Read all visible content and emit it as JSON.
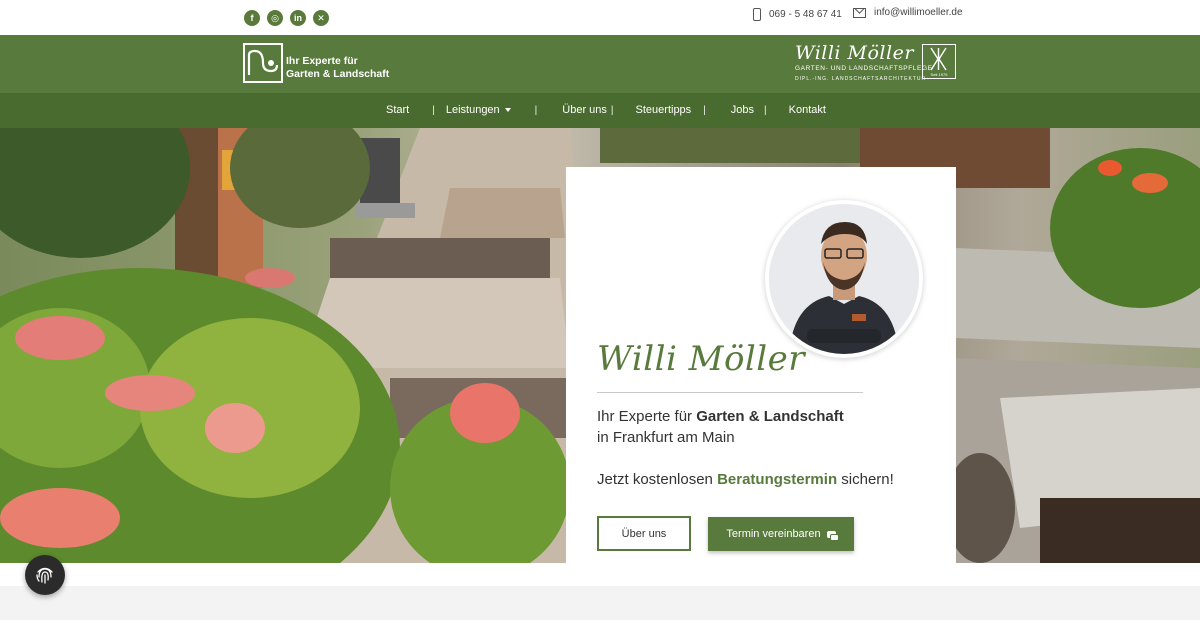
{
  "topbar": {
    "social": [
      {
        "name": "facebook-icon",
        "glyph": "f"
      },
      {
        "name": "instagram-icon",
        "glyph": "◎"
      },
      {
        "name": "linkedin-icon",
        "glyph": "in"
      },
      {
        "name": "xing-icon",
        "glyph": "✕"
      }
    ],
    "phone": "069 - 5 48 67 41",
    "email": "info@willimoeller.de"
  },
  "header": {
    "logo_line1": "Ihr Experte für",
    "logo_line2": "Garten & Landschaft",
    "brand_name": "Willi Möller",
    "brand_sub1": "GARTEN- UND LANDSCHAFTSPFLEGE",
    "brand_sub2": "DIPL.-ING. LANDSCHAFTSARCHITEKTUR",
    "brand_year": "Seit 1975"
  },
  "nav": {
    "items": [
      {
        "label": "Start"
      },
      {
        "label": "Leistungen"
      },
      {
        "label": "Über uns"
      },
      {
        "label": "Steuertipps"
      },
      {
        "label": "Jobs"
      },
      {
        "label": "Kontakt"
      }
    ]
  },
  "hero": {
    "name": "Willi Möller",
    "tagline_pre": "Ihr Experte für ",
    "tagline_bold": "Garten & Landschaft",
    "tagline_line2": "in Frankfurt am Main",
    "cta_pre": "Jetzt kostenlosen ",
    "cta_bold": "Beratungstermin",
    "cta_post": " sichern!",
    "button_about": "Über uns",
    "button_appointment": "Termin vereinbaren"
  },
  "colors": {
    "brand_green": "#587a3c",
    "nav_green": "#4a6b30"
  }
}
